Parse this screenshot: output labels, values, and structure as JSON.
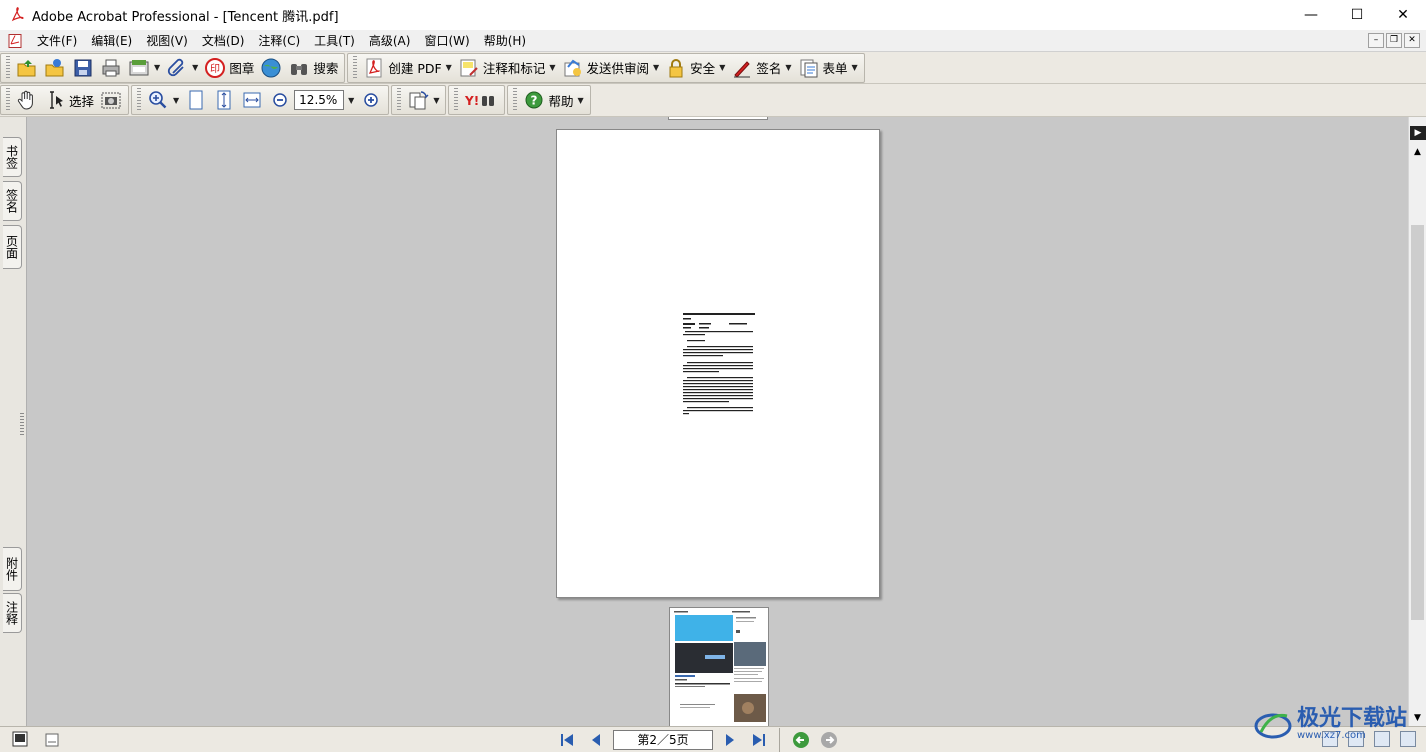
{
  "window": {
    "title": "Adobe Acrobat Professional - [Tencent 腾讯.pdf]",
    "controls": {
      "minimize": "—",
      "maximize": "☐",
      "close": "✕"
    }
  },
  "menubar": {
    "items": [
      "文件(F)",
      "编辑(E)",
      "视图(V)",
      "文档(D)",
      "注释(C)",
      "工具(T)",
      "高级(A)",
      "窗口(W)",
      "帮助(H)"
    ]
  },
  "toolbar1": {
    "stamp_label": "图章",
    "search_label": "搜索",
    "create_pdf_label": "创建 PDF",
    "comment_label": "注释和标记",
    "review_label": "发送供审阅",
    "security_label": "安全",
    "sign_label": "签名",
    "forms_label": "表单"
  },
  "toolbar2": {
    "select_label": "选择",
    "zoom_value": "12.5%",
    "help_label": "帮助"
  },
  "left_panel": {
    "tabs_top": [
      "书签",
      "签名",
      "页面"
    ],
    "tabs_bottom": [
      "附件",
      "注释"
    ]
  },
  "statusbar": {
    "page_display": "第2／5页"
  },
  "watermark": {
    "text": "极光下载站",
    "sub": "www.xz7.com"
  },
  "colors": {
    "accent_red": "#d42020",
    "toolbar_bg": "#ece9e2",
    "doc_bg": "#c8c8c8",
    "watermark_blue": "#2a5db0"
  }
}
